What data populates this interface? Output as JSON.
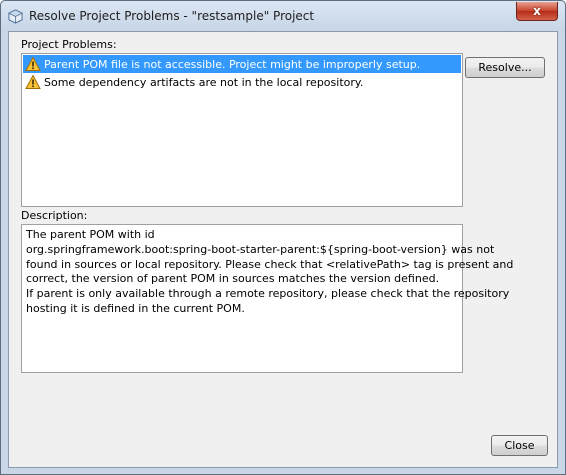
{
  "window": {
    "title": "Resolve Project Problems - \"restsample\" Project",
    "close_glyph": "x"
  },
  "problems": {
    "label": "Project Problems:",
    "items": [
      {
        "icon": "warning-icon",
        "text": "Parent POM file is not accessible. Project might be improperly setup.",
        "selected": true
      },
      {
        "icon": "warning-icon",
        "text": "Some dependency artifacts are not in the local repository.",
        "selected": false
      }
    ]
  },
  "description": {
    "label": "Description:",
    "lines": [
      "The parent POM with id",
      "org.springframework.boot:spring-boot-starter-parent:${spring-boot-version} was not",
      "found in sources or local repository. Please check that <relativePath> tag is present and",
      "correct, the version of parent POM in sources matches the version defined.",
      "If parent is only available through a remote repository, please check that the repository",
      "hosting it is defined in the current POM."
    ]
  },
  "buttons": {
    "resolve_label": "Resolve...",
    "close_label": "Close"
  },
  "colors": {
    "selection": "#3399ff",
    "warning_fill": "#f5c23a"
  }
}
